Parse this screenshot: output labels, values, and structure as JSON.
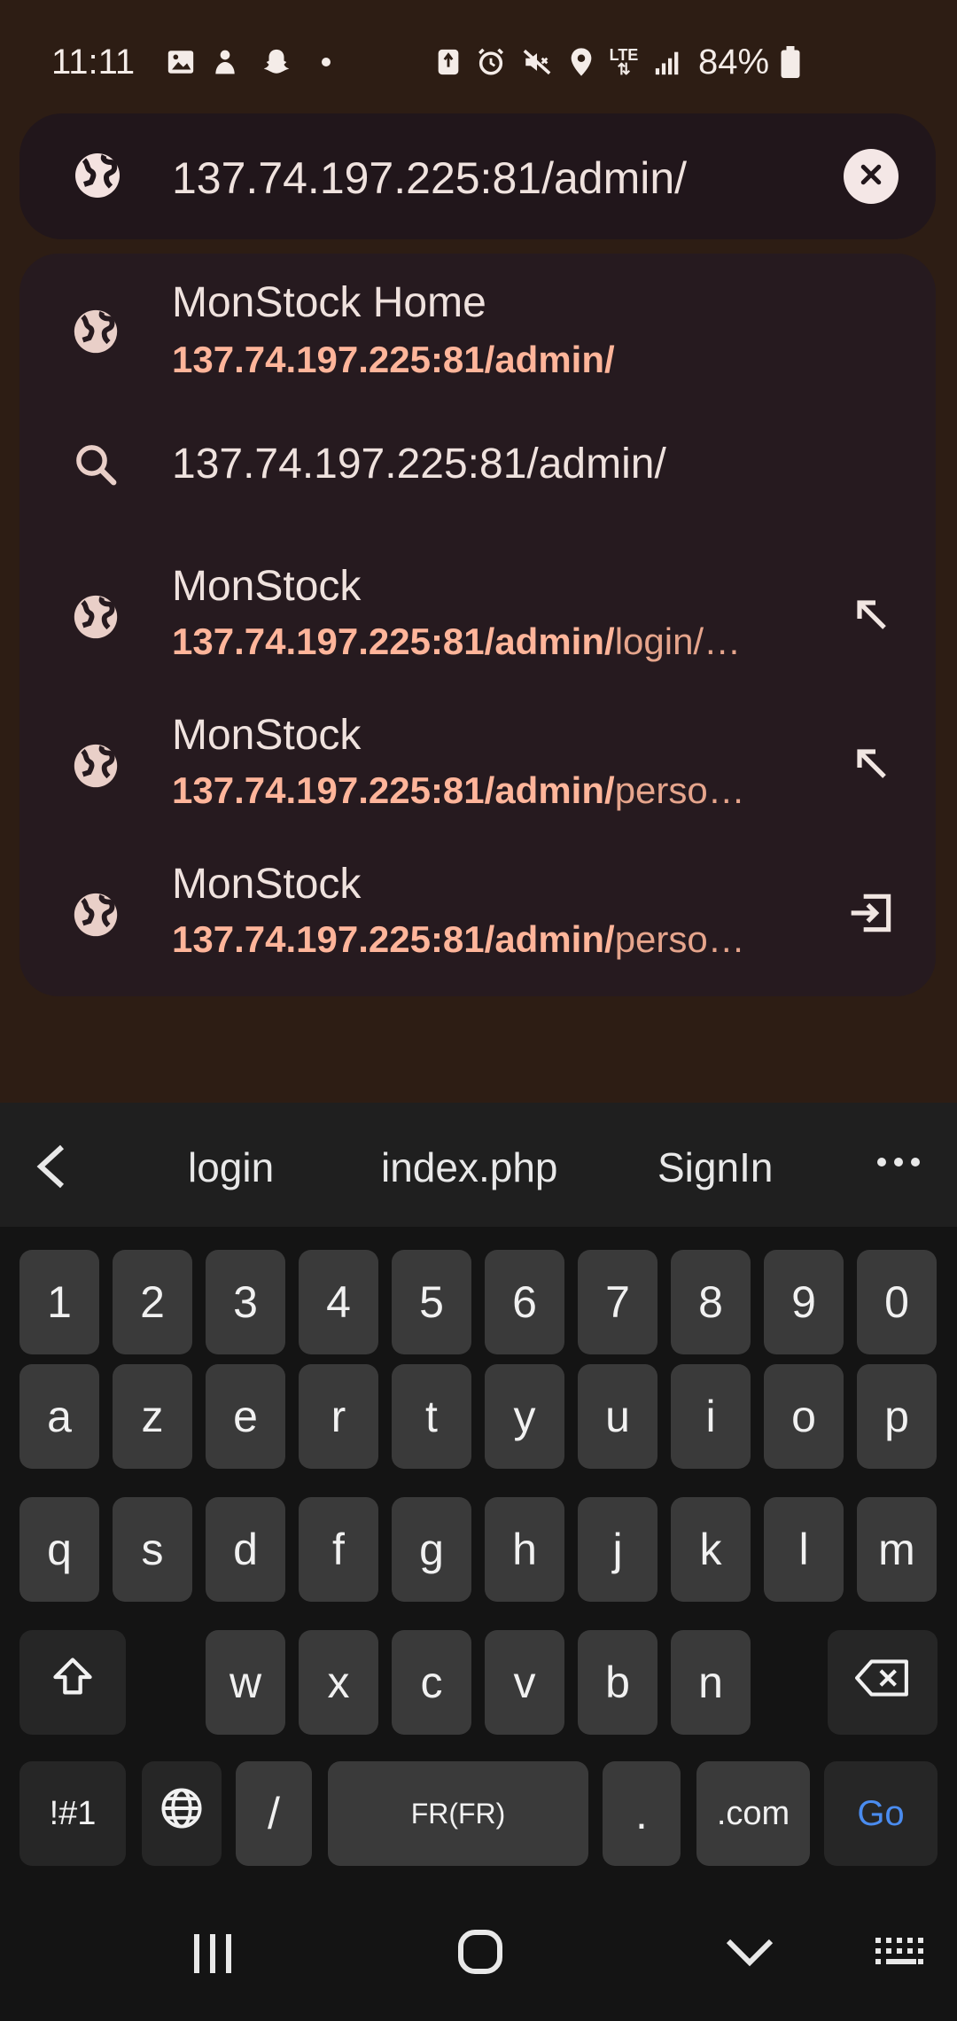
{
  "status_bar": {
    "time": "11:11",
    "battery_percent": "84%",
    "network": "LTE",
    "icons": [
      "gallery-icon",
      "app-icon",
      "snapchat-icon",
      "dot-icon",
      "recycle-icon",
      "alarm-icon",
      "mute-icon",
      "location-icon",
      "lte-icon",
      "signal-icon",
      "battery-icon"
    ]
  },
  "url_bar": {
    "value": "137.74.197.225:81/admin/"
  },
  "suggestions": [
    {
      "type": "site",
      "title": "MonStock Home",
      "url_highlight": "137.74.197.225:81/admin/",
      "url_rest": "",
      "action": ""
    },
    {
      "type": "search",
      "title": "137.74.197.225:81/admin/",
      "url_highlight": "",
      "url_rest": "",
      "action": ""
    },
    {
      "type": "site",
      "title": "MonStock",
      "url_highlight": "137.74.197.225:81/admin/",
      "url_rest": "login/…",
      "action": "fill-arrow"
    },
    {
      "type": "site",
      "title": "MonStock",
      "url_highlight": "137.74.197.225:81/admin/",
      "url_rest": "perso…",
      "action": "fill-arrow"
    },
    {
      "type": "site",
      "title": "MonStock",
      "url_highlight": "137.74.197.225:81/admin/",
      "url_rest": "perso…",
      "action": "switch-tab"
    }
  ],
  "keyboard": {
    "suggestions": [
      "login",
      "index.php",
      "SignIn"
    ],
    "row_numbers": [
      "1",
      "2",
      "3",
      "4",
      "5",
      "6",
      "7",
      "8",
      "9",
      "0"
    ],
    "row1": [
      "a",
      "z",
      "e",
      "r",
      "t",
      "y",
      "u",
      "i",
      "o",
      "p"
    ],
    "row2": [
      "q",
      "s",
      "d",
      "f",
      "g",
      "h",
      "j",
      "k",
      "l",
      "m"
    ],
    "row3": [
      "w",
      "x",
      "c",
      "v",
      "b",
      "n"
    ],
    "symbols_label": "!#1",
    "slash_label": "/",
    "space_label": "FR(FR)",
    "period_label": ".",
    "com_label": ".com",
    "go_label": "Go"
  },
  "colors": {
    "background": "#2d1d14",
    "panel": "#261a1f",
    "url_highlight": "#ffb59a",
    "go_accent": "#4a8cf0"
  }
}
